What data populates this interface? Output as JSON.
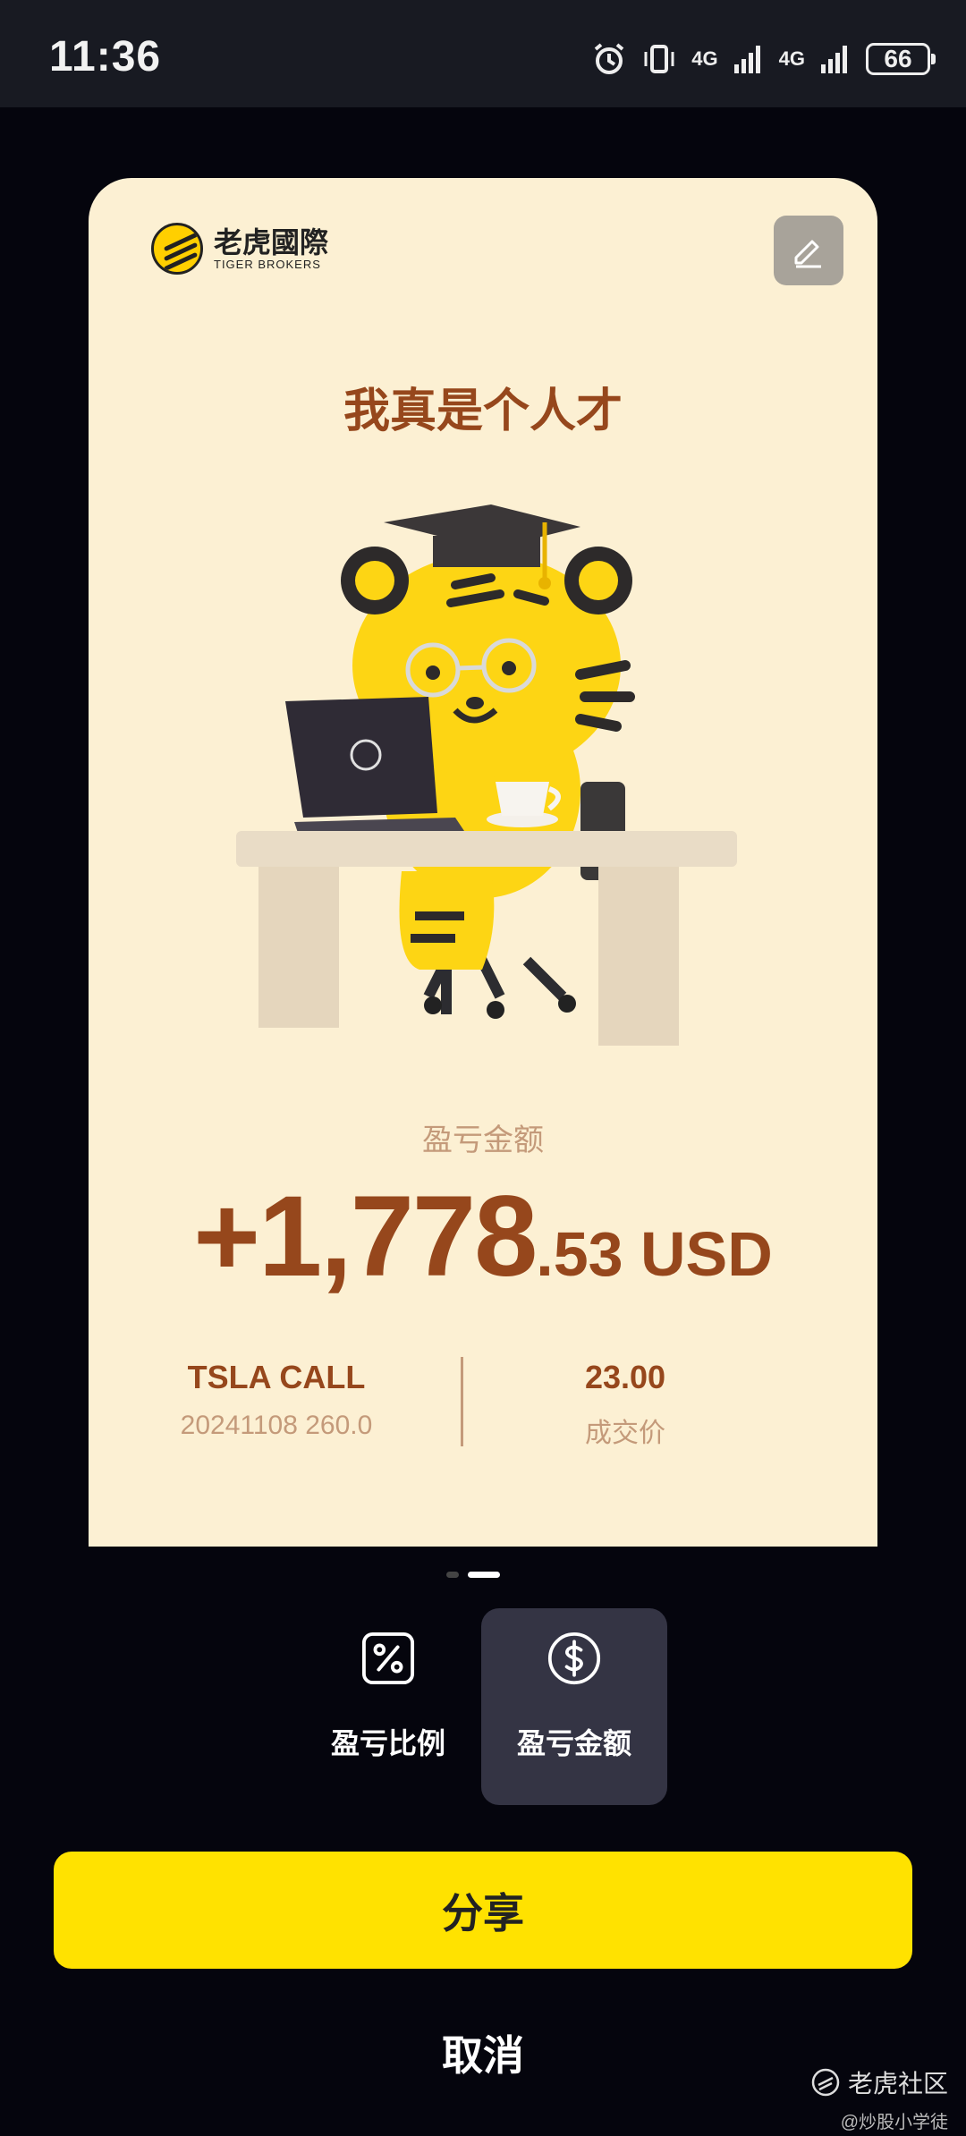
{
  "status_bar": {
    "time": "11:36",
    "network1": "4G",
    "network2": "4G",
    "battery": "66"
  },
  "card": {
    "logo_cn": "老虎國際",
    "logo_en": "TIGER BROKERS",
    "title": "我真是个人才",
    "pnl_label": "盈亏金额",
    "pnl_integer": "+1,778",
    "pnl_decimal": ".53 USD",
    "symbol": "TSLA CALL",
    "contract": "20241108 260.0",
    "price": "23.00",
    "price_label": "成交价"
  },
  "pagination": {
    "current": 2,
    "total": 2
  },
  "options": [
    {
      "label": "盈亏比例",
      "icon": "percent-icon",
      "selected": false
    },
    {
      "label": "盈亏金额",
      "icon": "dollar-icon",
      "selected": true
    }
  ],
  "actions": {
    "share": "分享",
    "cancel": "取消"
  },
  "watermark": {
    "main": "老虎社区",
    "sub": "@炒股小学徒"
  },
  "colors": {
    "accent_yellow": "#ffe200",
    "card_bg": "#fcf0d3",
    "pnl_brown": "#96471c"
  }
}
